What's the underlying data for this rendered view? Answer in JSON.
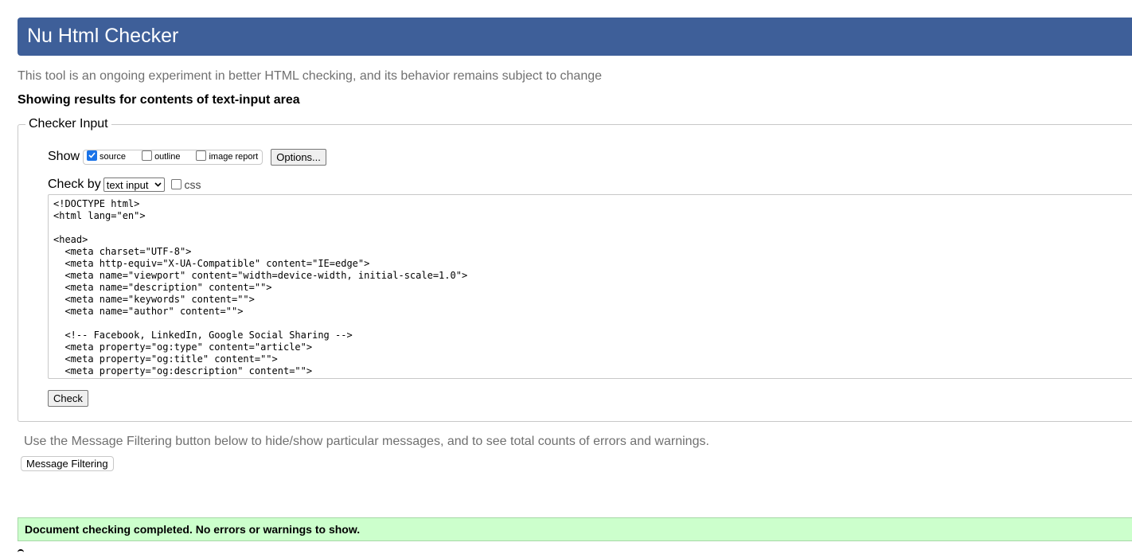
{
  "header": {
    "title": "Nu Html Checker"
  },
  "tagline": "This tool is an ongoing experiment in better HTML checking, and its behavior remains subject to change",
  "showing": "Showing results for contents of text-input area",
  "checker_input": {
    "legend": "Checker Input",
    "show": {
      "label": "Show",
      "options": [
        {
          "label": "source",
          "checked": true
        },
        {
          "label": "outline",
          "checked": false
        },
        {
          "label": "image report",
          "checked": false
        }
      ],
      "options_button": "Options..."
    },
    "check_by": {
      "label": "Check by",
      "selected": "text input",
      "css_label": "css",
      "css_checked": false
    },
    "source_text": "<!DOCTYPE html>\n<html lang=\"en\">\n\n<head>\n  <meta charset=\"UTF-8\">\n  <meta http-equiv=\"X-UA-Compatible\" content=\"IE=edge\">\n  <meta name=\"viewport\" content=\"width=device-width, initial-scale=1.0\">\n  <meta name=\"description\" content=\"\">\n  <meta name=\"keywords\" content=\"\">\n  <meta name=\"author\" content=\"\">\n\n  <!-- Facebook, LinkedIn, Google Social Sharing -->\n  <meta property=\"og:type\" content=\"article\">\n  <meta property=\"og:title\" content=\"\">\n  <meta property=\"og:description\" content=\"\">",
    "check_button": "Check"
  },
  "filtering": {
    "note": "Use the Message Filtering button below to hide/show particular messages, and to see total counts of errors and warnings.",
    "button": "Message Filtering"
  },
  "result": {
    "message": "Document checking completed. No errors or warnings to show."
  },
  "colors": {
    "header_bg": "#3e5f99",
    "success_bg": "#ccffcc",
    "checkbox_checked": "#1a73e8"
  }
}
